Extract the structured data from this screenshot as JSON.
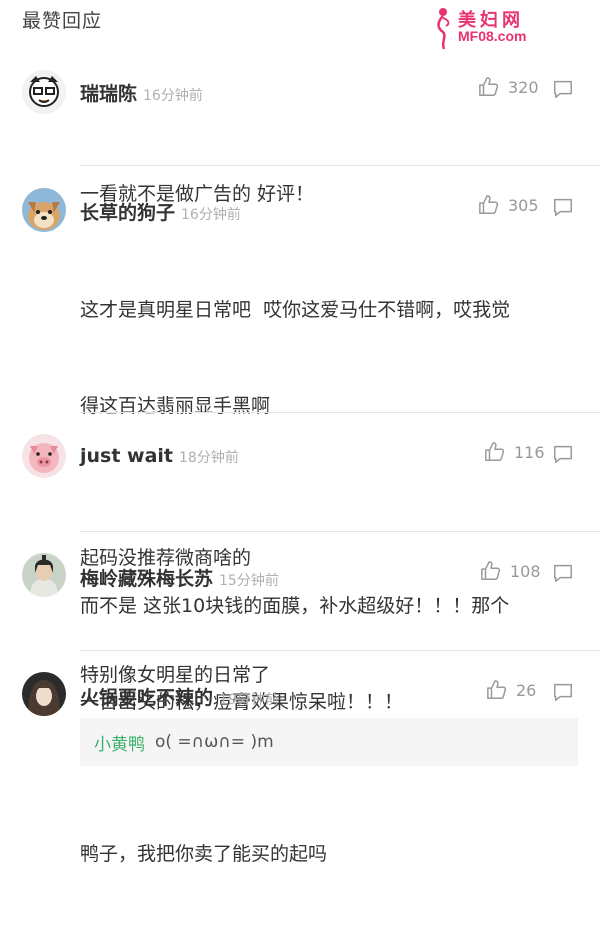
{
  "section_title": "最赞回应",
  "watermark": {
    "name": "美妇网",
    "url": "MF08.com"
  },
  "comments": [
    {
      "username": "瑞瑞陈",
      "time": "16分钟前",
      "likes": "320",
      "lines": [
        "一看就不是做广告的 好评！"
      ]
    },
    {
      "username": "长草的狗子",
      "time": "16分钟前",
      "likes": "305",
      "lines": [
        "这才是真明星日常吧  哎你这爱马仕不错啊，哎我觉",
        "得这百达翡丽显手黑啊",
        "",
        "而不是 这张10块钱的面膜，补水超级好！！！那个",
        "一百出头的祛，痘膏效果惊呆啦！！！"
      ]
    },
    {
      "username": "just wait",
      "time": "18分钟前",
      "likes": "116",
      "lines": [
        "起码没推荐微商啥的"
      ]
    },
    {
      "username": "梅岭藏殊梅长苏",
      "time": "15分钟前",
      "likes": "108",
      "lines": [
        "特别像女明星的日常了"
      ]
    },
    {
      "username": "火锅要吃不辣的",
      "time": "19分钟前",
      "likes": "26",
      "quote_user": "小黄鸭",
      "quote_text": "o( =∩ω∩= )m",
      "lines": [
        "鸭子，我把你卖了能买的起吗"
      ]
    }
  ],
  "colors": {
    "text": "#333333",
    "muted": "#b0b0b0",
    "watermark": "#e8336d",
    "quote_user": "#3bb36b",
    "quote_bg": "#f5f5f5",
    "divider": "#e6e6e6"
  },
  "icons": {
    "like": "thumbs-up-icon",
    "reply": "speech-bubble-icon"
  }
}
